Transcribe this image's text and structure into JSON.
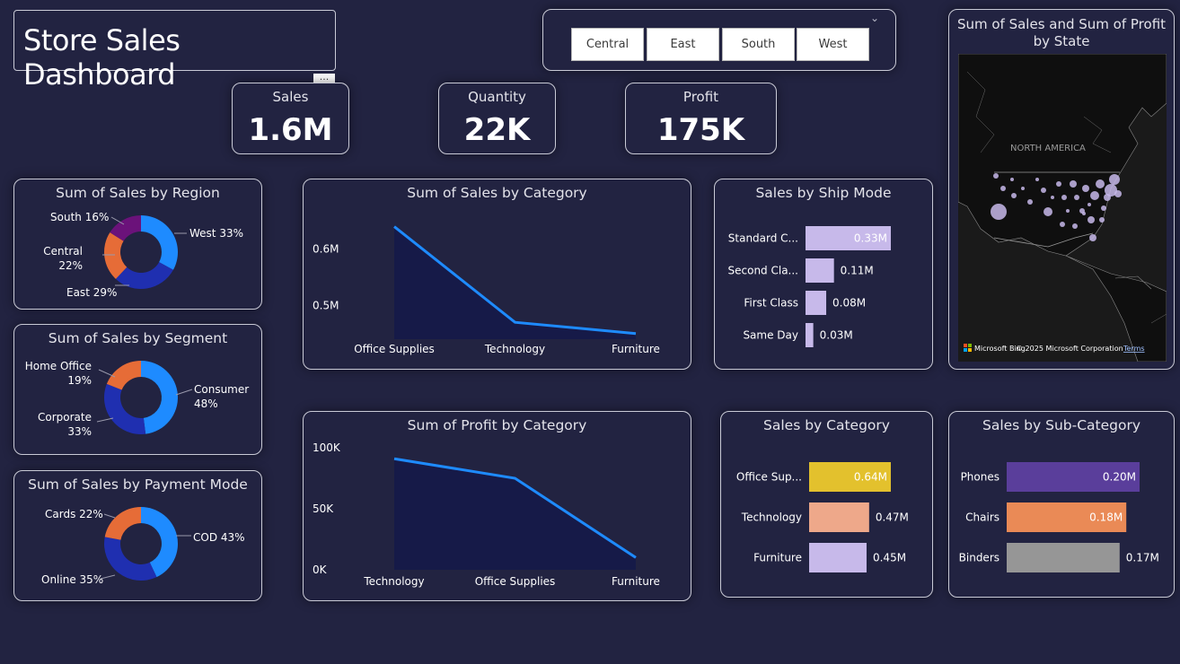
{
  "header": {
    "title": "Store Sales Dashboard",
    "more_label": "···"
  },
  "slicer": {
    "options": [
      "Central",
      "East",
      "South",
      "West"
    ]
  },
  "kpis": {
    "sales": {
      "label": "Sales",
      "value": "1.6M"
    },
    "quantity": {
      "label": "Quantity",
      "value": "22K"
    },
    "profit": {
      "label": "Profit",
      "value": "175K"
    }
  },
  "colors": {
    "background": "#222341",
    "blue": "#1e8bff",
    "dark_blue": "#1f2fb0",
    "orange": "#e66c37",
    "purple": "#6b127a",
    "lavender": "#c7b9ea",
    "yellow": "#e3c12d",
    "peach": "#eea88a",
    "violet": "#5a3e9b",
    "salmon": "#ea8a56",
    "gray": "#969696"
  },
  "map": {
    "title": "Sum of Sales and Sum of Profit by State",
    "region_label": "NORTH AMERICA",
    "attribution": "© 2025 Microsoft Corporation",
    "brand": "Microsoft Bing",
    "terms": "Terms"
  },
  "chart_data": [
    {
      "id": "region",
      "type": "pie",
      "title": "Sum of Sales by Region",
      "categories": [
        "West",
        "East",
        "Central",
        "South"
      ],
      "values": [
        33,
        29,
        22,
        16
      ],
      "labels": [
        "West 33%",
        "East 29%",
        "Central 22%",
        "South 16%"
      ]
    },
    {
      "id": "segment",
      "type": "pie",
      "title": "Sum of Sales by Segment",
      "categories": [
        "Consumer",
        "Corporate",
        "Home Office"
      ],
      "values": [
        48,
        33,
        19
      ],
      "labels": [
        "Consumer 48%",
        "Corporate 33%",
        "Home Office 19%"
      ]
    },
    {
      "id": "payment",
      "type": "pie",
      "title": "Sum of Sales by Payment Mode",
      "categories": [
        "COD",
        "Online",
        "Cards"
      ],
      "values": [
        43,
        35,
        22
      ],
      "labels": [
        "COD 43%",
        "Online 35%",
        "Cards 22%"
      ]
    },
    {
      "id": "sales_by_category",
      "type": "area",
      "title": "Sum of Sales by Category",
      "categories": [
        "Office Supplies",
        "Technology",
        "Furniture"
      ],
      "values": [
        0.64,
        0.47,
        0.45
      ],
      "ylim": [
        0.44,
        0.66
      ],
      "yticks": [
        0.5,
        0.6
      ],
      "ytick_labels": [
        "0.5M",
        "0.6M"
      ]
    },
    {
      "id": "profit_by_category",
      "type": "area",
      "title": "Sum of Profit by Category",
      "categories": [
        "Technology",
        "Office Supplies",
        "Furniture"
      ],
      "values": [
        91000,
        75000,
        10000
      ],
      "ylim": [
        0,
        100000
      ],
      "yticks": [
        0,
        50000,
        100000
      ],
      "ytick_labels": [
        "0K",
        "50K",
        "100K"
      ]
    },
    {
      "id": "ship_mode",
      "type": "bar",
      "title": "Sales by Ship Mode",
      "categories": [
        "Standard C...",
        "Second Cla...",
        "First Class",
        "Same Day"
      ],
      "values": [
        0.33,
        0.11,
        0.08,
        0.03
      ],
      "labels": [
        "0.33M",
        "0.11M",
        "0.08M",
        "0.03M"
      ]
    },
    {
      "id": "sales_by_category_bar",
      "type": "bar",
      "title": "Sales by Category",
      "categories": [
        "Office Sup...",
        "Technology",
        "Furniture"
      ],
      "values": [
        0.64,
        0.47,
        0.45
      ],
      "labels": [
        "0.64M",
        "0.47M",
        "0.45M"
      ]
    },
    {
      "id": "sub_category",
      "type": "bar",
      "title": "Sales by Sub-Category",
      "categories": [
        "Phones",
        "Chairs",
        "Binders"
      ],
      "values": [
        0.2,
        0.18,
        0.17
      ],
      "labels": [
        "0.20M",
        "0.18M",
        "0.17M"
      ]
    }
  ]
}
